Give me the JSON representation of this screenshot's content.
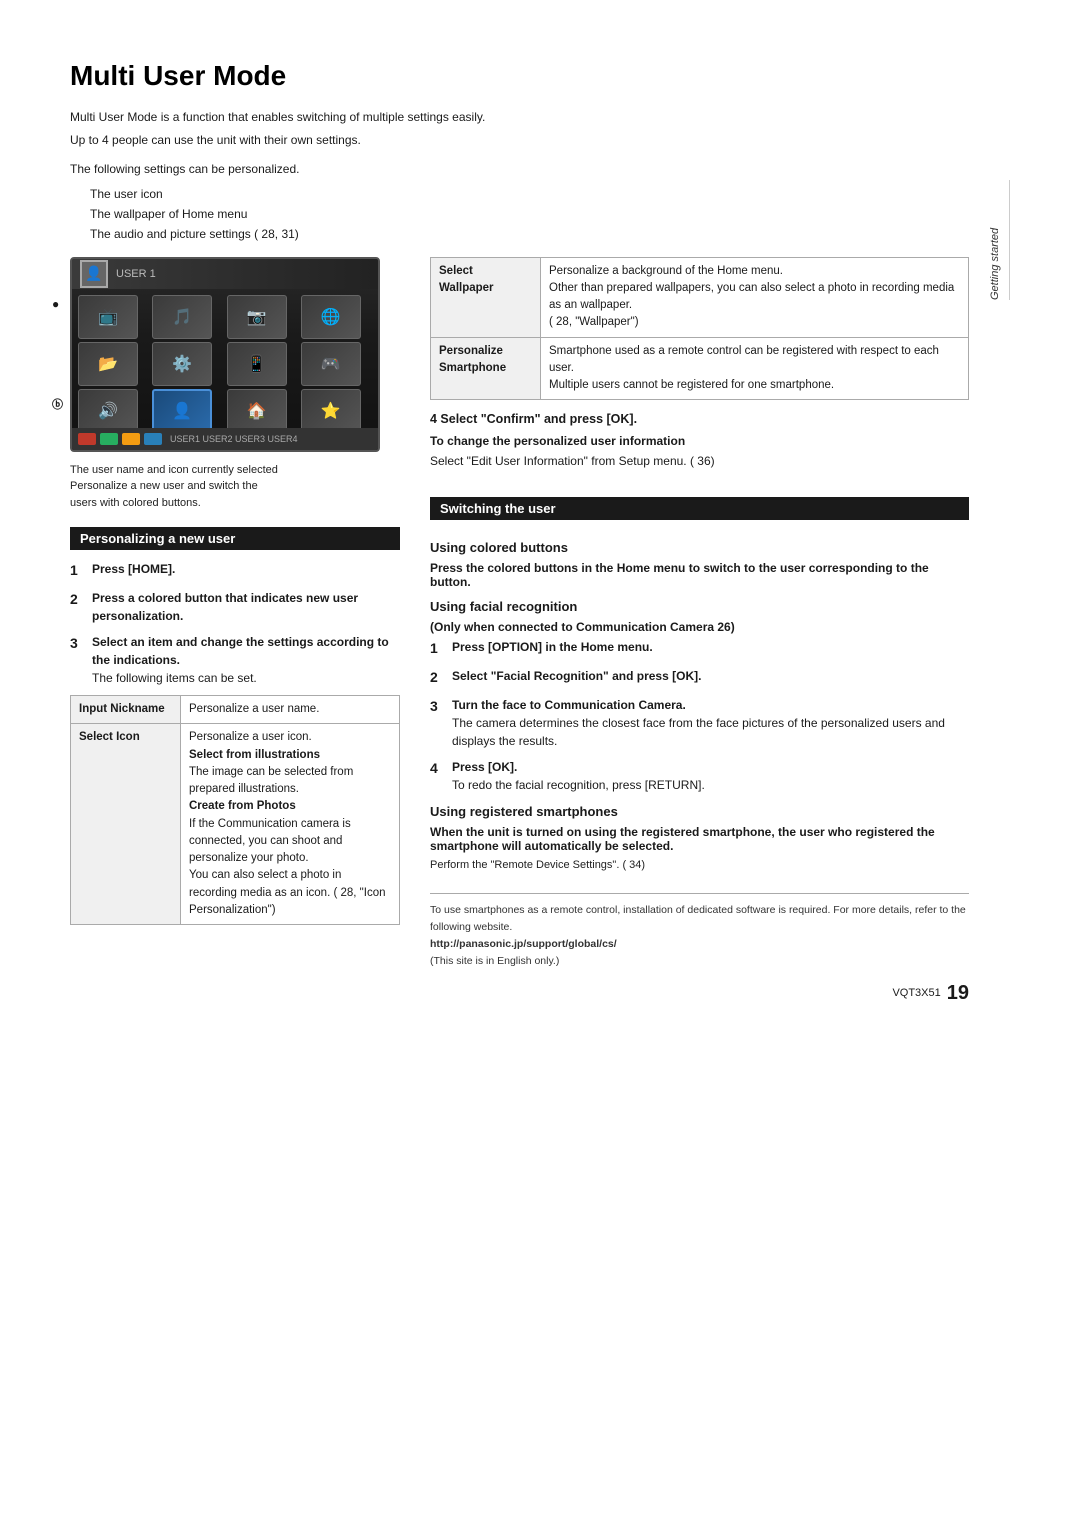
{
  "page": {
    "title": "Multi User Mode",
    "side_tab": "Getting started",
    "page_code": "VQT3X51",
    "page_number": "19"
  },
  "intro": {
    "para1": "Multi User Mode is a function that enables switching of multiple settings easily.",
    "para2": "Up to 4 people can use the unit with their own settings.",
    "settings_header": "The following settings can be personalized.",
    "settings_items": [
      "The user icon",
      "The wallpaper of Home menu",
      "The audio and picture settings (  28, 31)"
    ]
  },
  "tv_caption": "The user name and icon currently selected\nPersonalize a new user and switch the users with colored buttons.",
  "section1": {
    "heading": "Personalizing a new user",
    "step1": {
      "num": "1",
      "text": "Press [HOME]."
    },
    "step2": {
      "num": "2",
      "text_bold": "Press a colored button that indicates new user personalization."
    },
    "step3": {
      "num": "3",
      "text_bold": "Select an item and change the settings according to the indications.",
      "note": "The following items can be set."
    }
  },
  "table1": {
    "rows": [
      {
        "col1": "Input Nickname",
        "col2": "Personalize a user name."
      },
      {
        "col1": "Select Icon",
        "col2_parts": [
          "Personalize a user icon.",
          "Select from illustrations",
          "The image can be selected from prepared illustrations.",
          "Create from Photos",
          "If the Communication camera is connected, you can shoot and personalize your photo.",
          "You can also select a photo in recording media as an icon. (  28, \"Icon Personalization\")"
        ]
      }
    ]
  },
  "table2": {
    "rows": [
      {
        "col1_bold": "Select\nWallpaper",
        "col2_parts": [
          "Personalize a background of the Home menu.",
          "Other than prepared wallpapers, you can also select a photo in recording media as an wallpaper.",
          "( 28, \"Wallpaper\")"
        ]
      },
      {
        "col1_bold": "Personalize\nSmartphone",
        "col2_parts": [
          "Smartphone used as a remote control can be registered with respect to each user.",
          "Multiple users cannot be registered for one smartphone."
        ]
      }
    ]
  },
  "step4_confirm": "4  Select \"Confirm\" and press [OK].",
  "change_user_info": {
    "bold_label": "To change the personalized user information",
    "text": "Select \"Edit User Information\" from Setup menu. (  36)"
  },
  "section2": {
    "heading": "Switching the user",
    "sub1": {
      "heading": "Using colored buttons",
      "bold_text": "Press the colored buttons in the Home menu to switch to the user corresponding to the button."
    },
    "sub2": {
      "heading": "Using facial recognition",
      "sub_note": "(Only when connected to Communication Camera  26)",
      "step1": {
        "num": "1",
        "text": "Press [OPTION] in the Home menu."
      },
      "step2": {
        "num": "2",
        "text": "Select \"Facial Recognition\" and press [OK]."
      },
      "step3": {
        "num": "3",
        "text": "Turn the face to Communication Camera.",
        "note": "The camera determines the closest face from the face pictures of the personalized users and displays the results."
      },
      "step4": {
        "num": "4",
        "text": "Press [OK].",
        "note": "To redo the facial recognition, press [RETURN]."
      }
    },
    "sub3": {
      "heading": "Using registered smartphones",
      "bold_text": "When the unit is turned on using the registered smartphone, the user who registered the smartphone will automatically be selected.",
      "note": "Perform the \"Remote Device Settings\". (  34)"
    }
  },
  "footer": {
    "line1": "To use smartphones as a remote control, installation of dedicated software is required. For more details, refer to the following website.",
    "website": "http://panasonic.jp/support/global/cs/",
    "note": "(This site is in English only.)"
  }
}
